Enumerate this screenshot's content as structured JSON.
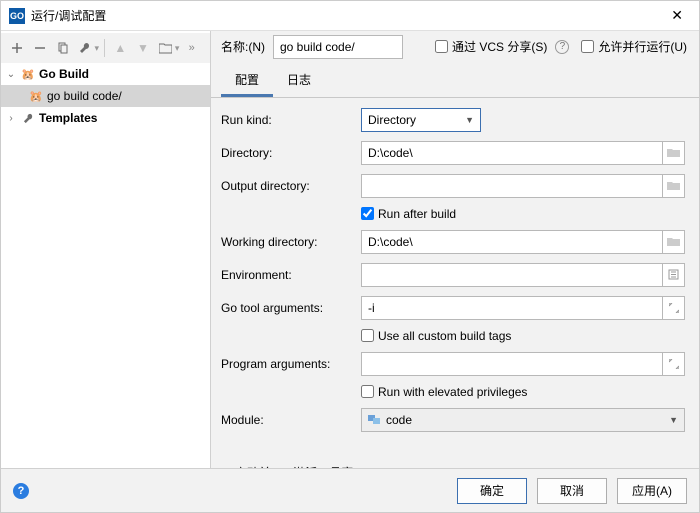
{
  "window": {
    "title": "运行/调试配置"
  },
  "tree": {
    "gobuild_label": "Go Build",
    "gobuild_child": "go build code/",
    "templates_label": "Templates"
  },
  "name": {
    "label": "名称:(N)",
    "value": "go build code/"
  },
  "share": {
    "label": "通过 VCS 分享(S)"
  },
  "parallel": {
    "label": "允许并行运行(U)"
  },
  "tabs": {
    "config": "配置",
    "log": "日志"
  },
  "form": {
    "run_kind_label": "Run kind:",
    "run_kind_value": "Directory",
    "directory_label": "Directory:",
    "directory_value": "D:\\code\\",
    "output_dir_label": "Output directory:",
    "output_dir_value": "",
    "run_after_build_label": "Run after build",
    "working_dir_label": "Working directory:",
    "working_dir_value": "D:\\code\\",
    "env_label": "Environment:",
    "env_value": "",
    "tool_args_label": "Go tool arguments:",
    "tool_args_value": "-i",
    "use_custom_tags_label": "Use all custom build tags",
    "prog_args_label": "Program arguments:",
    "prog_args_value": "",
    "elevated_label": "Run with elevated privileges",
    "module_label": "Module:",
    "module_value": "code"
  },
  "before_launch": {
    "label": "启动前(B): 激活工具窗口"
  },
  "buttons": {
    "ok": "确定",
    "cancel": "取消",
    "apply": "应用(A)"
  }
}
